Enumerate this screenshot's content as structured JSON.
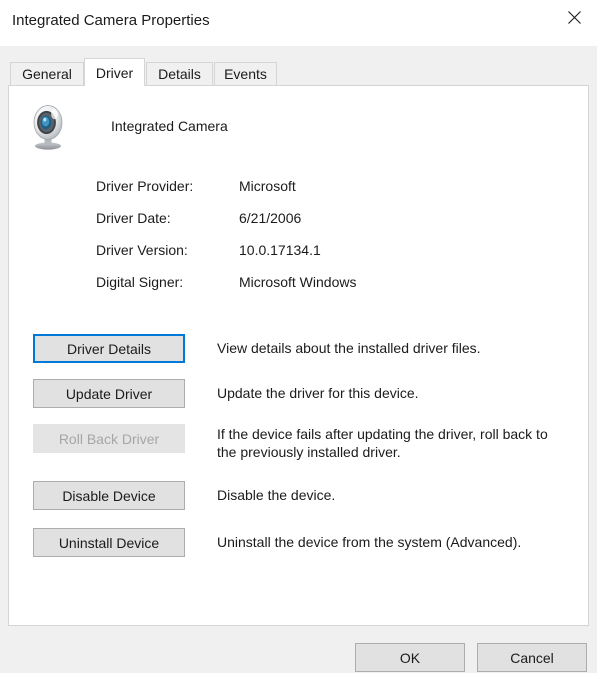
{
  "window": {
    "title": "Integrated Camera Properties",
    "close_icon": "close-icon"
  },
  "tabs": [
    {
      "label": "General",
      "active": false
    },
    {
      "label": "Driver",
      "active": true
    },
    {
      "label": "Details",
      "active": false
    },
    {
      "label": "Events",
      "active": false
    }
  ],
  "device": {
    "icon": "webcam-icon",
    "name": "Integrated Camera"
  },
  "driver_info": [
    {
      "label": "Driver Provider:",
      "value": "Microsoft"
    },
    {
      "label": "Driver Date:",
      "value": "6/21/2006"
    },
    {
      "label": "Driver Version:",
      "value": "10.0.17134.1"
    },
    {
      "label": "Digital Signer:",
      "value": "Microsoft Windows"
    }
  ],
  "actions": [
    {
      "button": "Driver Details",
      "description": "View details about the installed driver files.",
      "state": "focused"
    },
    {
      "button": "Update Driver",
      "description": "Update the driver for this device.",
      "state": "normal"
    },
    {
      "button": "Roll Back Driver",
      "description": "If the device fails after updating the driver, roll back to the previously installed driver.",
      "state": "disabled"
    },
    {
      "button": "Disable Device",
      "description": "Disable the device.",
      "state": "normal"
    },
    {
      "button": "Uninstall Device",
      "description": "Uninstall the device from the system (Advanced).",
      "state": "normal"
    }
  ],
  "footer": {
    "ok_label": "OK",
    "cancel_label": "Cancel"
  },
  "colors": {
    "accent": "#0078d7",
    "dialog_background": "#f0f0f0",
    "panel_background": "#ffffff",
    "button_face": "#e1e1e1",
    "disabled_text": "#a6a6a6",
    "text": "#1b1b1b"
  }
}
